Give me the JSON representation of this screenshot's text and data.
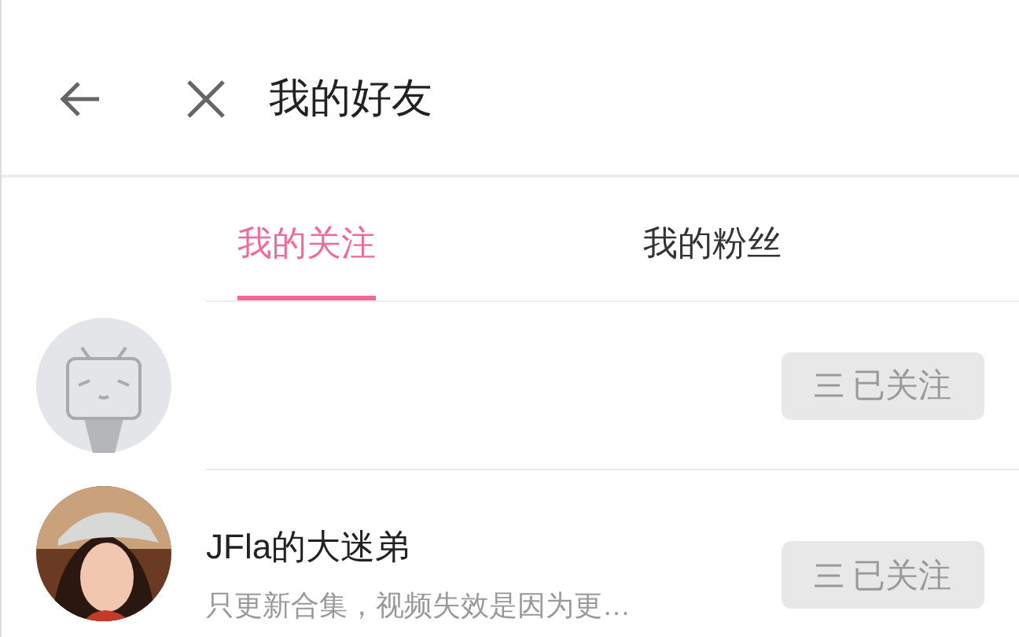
{
  "header": {
    "title": "我的好友"
  },
  "tabs": [
    {
      "label": "我的关注",
      "selected": true
    },
    {
      "label": "我的粉丝",
      "selected": false
    }
  ],
  "users": [
    {
      "kind": "default",
      "button": "已关注"
    },
    {
      "kind": "picture",
      "name": "JFla的大迷弟",
      "description": "只更新合集，视频失效是因为更…",
      "button": "已关注"
    }
  ]
}
